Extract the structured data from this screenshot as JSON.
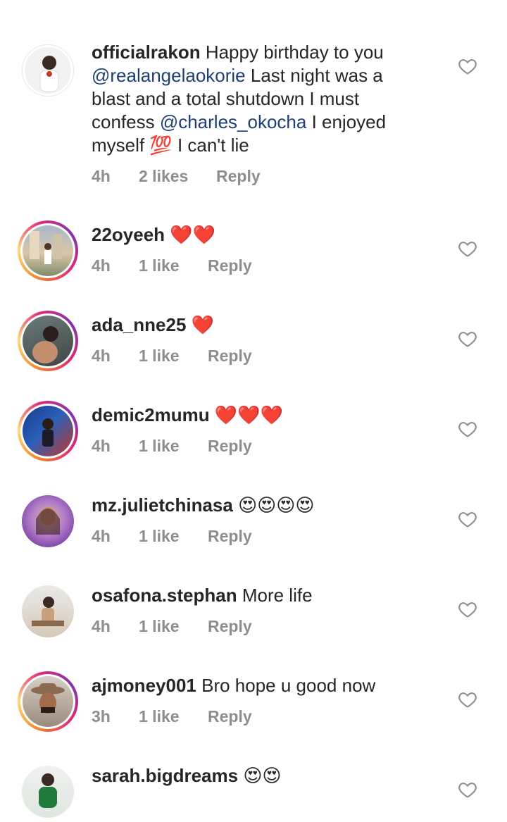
{
  "comments": [
    {
      "username": "officialrakon",
      "parts": [
        {
          "t": "text",
          "v": " Happy birthday to you "
        },
        {
          "t": "mention",
          "v": "@realangelaokorie"
        },
        {
          "t": "text",
          "v": " Last night was a blast and a total shutdown I must confess "
        },
        {
          "t": "mention",
          "v": "@charles_okocha"
        },
        {
          "t": "text",
          "v": " I enjoyed myself 💯 I can't lie"
        }
      ],
      "time": "4h",
      "likes": "2 likes",
      "reply": "Reply",
      "story_ring": false
    },
    {
      "username": "22oyeeh",
      "text": "❤️❤️",
      "time": "4h",
      "likes": "1 like",
      "reply": "Reply",
      "story_ring": true
    },
    {
      "username": "ada_nne25",
      "text": "❤️",
      "time": "4h",
      "likes": "1 like",
      "reply": "Reply",
      "story_ring": true
    },
    {
      "username": "demic2mumu",
      "text": "❤️❤️❤️",
      "time": "4h",
      "likes": "1 like",
      "reply": "Reply",
      "story_ring": true
    },
    {
      "username": "mz.julietchinasa",
      "text": "😍😍😍😍",
      "time": "4h",
      "likes": "1 like",
      "reply": "Reply",
      "story_ring": false
    },
    {
      "username": "osafona.stephan",
      "text": "More life",
      "time": "4h",
      "likes": "1 like",
      "reply": "Reply",
      "story_ring": false
    },
    {
      "username": "ajmoney001",
      "text": "Bro hope u good now",
      "time": "3h",
      "likes": "1 like",
      "reply": "Reply",
      "story_ring": true
    },
    {
      "username": "sarah.bigdreams",
      "text": "😍😍",
      "time": "",
      "likes": "",
      "reply": "",
      "story_ring": false
    }
  ],
  "icons": {
    "like": "heart-outline-icon"
  },
  "colors": {
    "mention": "#1d3f77",
    "meta": "#8e8e8e",
    "text": "#262626"
  }
}
